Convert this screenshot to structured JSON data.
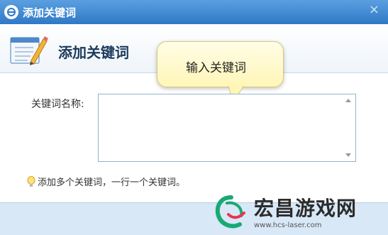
{
  "dialog": {
    "title": "添加关键词",
    "close_label": "×",
    "header_title": "添加关键词",
    "tooltip": "输入关键词",
    "field_label": "关键词名称:",
    "textarea_value": "",
    "hint": "添加多个关键词，一行一个关键词。"
  },
  "watermark": {
    "brand": "宏昌游戏网",
    "url": "www.hcs-laser.com"
  },
  "colors": {
    "titlebar": "#2f78c6",
    "footer": "#d8e8f6",
    "tooltip_bg": "#fff6b8",
    "watermark_green": "#19a974",
    "watermark_red": "#e8364f"
  },
  "icons": [
    "browser-logo-icon",
    "notepad-pencil-icon",
    "lightbulb-icon"
  ]
}
